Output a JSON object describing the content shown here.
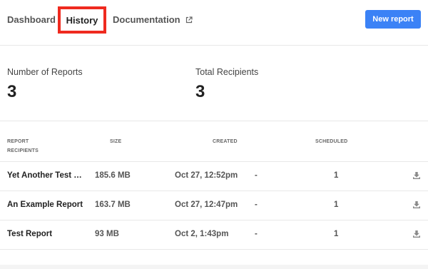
{
  "nav": {
    "dashboard": "Dashboard",
    "history": "History",
    "documentation": "Documentation",
    "documentation_icon": "external-link-icon",
    "new_report": "New report"
  },
  "stats": {
    "reports_label": "Number of Reports",
    "reports_value": "3",
    "recipients_label": "Total Recipients",
    "recipients_value": "3"
  },
  "table": {
    "headers": {
      "report": "REPORT",
      "recipients": "RECIPIENTS",
      "size": "SIZE",
      "created": "CREATED",
      "scheduled": "SCHEDULED"
    },
    "rows": [
      {
        "name": "Yet Another Test Report",
        "size": "185.6 MB",
        "created": "Oct 27, 12:52pm",
        "recipients": "-",
        "scheduled": "1"
      },
      {
        "name": "An Example Report",
        "size": "163.7 MB",
        "created": "Oct 27, 12:47pm",
        "recipients": "-",
        "scheduled": "1"
      },
      {
        "name": "Test Report",
        "size": "93 MB",
        "created": "Oct 2, 1:43pm",
        "recipients": "-",
        "scheduled": "1"
      }
    ],
    "row_action_icon": "download-icon"
  },
  "colors": {
    "accent": "#3b82f6",
    "highlight": "#ef2a1f"
  }
}
